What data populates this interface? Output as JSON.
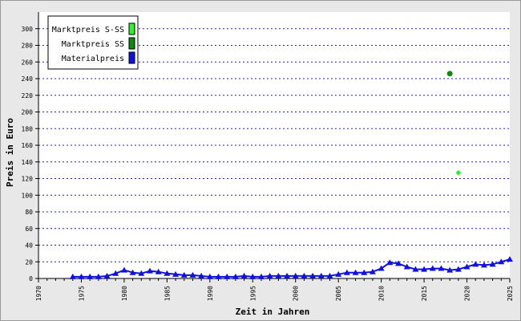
{
  "chart_data": {
    "type": "line",
    "title": "",
    "xlabel": "Zeit in Jahren",
    "ylabel": "Preis in Euro",
    "xlim": [
      1970,
      2025
    ],
    "ylim": [
      0,
      320
    ],
    "x_ticks": [
      "1970",
      "1975",
      "1980",
      "1985",
      "1990",
      "1995",
      "2000",
      "2005",
      "2010",
      "2015",
      "2020",
      "2025"
    ],
    "y_ticks": [
      "0",
      "20",
      "40",
      "60",
      "80",
      "100",
      "120",
      "140",
      "160",
      "180",
      "200",
      "220",
      "240",
      "260",
      "280",
      "300"
    ],
    "grid": true,
    "legend_position": "top-left",
    "series": [
      {
        "name": "Marktpreis S-SS",
        "color": "#33ee33",
        "marker": "diamond",
        "points": [
          [
            2019,
            127
          ]
        ]
      },
      {
        "name": "Marktpreis SS",
        "color": "#118811",
        "marker": "circle",
        "points": [
          [
            2018,
            246
          ]
        ]
      },
      {
        "name": "Materialpreis",
        "color": "#1111dd",
        "marker": "triangle",
        "points": [
          [
            1974,
            2
          ],
          [
            1975,
            2
          ],
          [
            1976,
            2
          ],
          [
            1977,
            2
          ],
          [
            1978,
            3
          ],
          [
            1979,
            6
          ],
          [
            1980,
            10
          ],
          [
            1981,
            7
          ],
          [
            1982,
            6
          ],
          [
            1983,
            9
          ],
          [
            1984,
            8
          ],
          [
            1985,
            6
          ],
          [
            1986,
            5
          ],
          [
            1987,
            4
          ],
          [
            1988,
            4
          ],
          [
            1989,
            3
          ],
          [
            1990,
            2
          ],
          [
            1991,
            2
          ],
          [
            1992,
            2
          ],
          [
            1993,
            2
          ],
          [
            1994,
            3
          ],
          [
            1995,
            2
          ],
          [
            1996,
            2
          ],
          [
            1997,
            3
          ],
          [
            1998,
            3
          ],
          [
            1999,
            3
          ],
          [
            2000,
            3
          ],
          [
            2001,
            3
          ],
          [
            2002,
            3
          ],
          [
            2003,
            3
          ],
          [
            2004,
            3
          ],
          [
            2005,
            5
          ],
          [
            2006,
            7
          ],
          [
            2007,
            7
          ],
          [
            2008,
            7
          ],
          [
            2009,
            8
          ],
          [
            2010,
            12
          ],
          [
            2011,
            19
          ],
          [
            2012,
            18
          ],
          [
            2013,
            14
          ],
          [
            2014,
            11
          ],
          [
            2015,
            11
          ],
          [
            2016,
            12
          ],
          [
            2017,
            12
          ],
          [
            2018,
            10
          ],
          [
            2019,
            11
          ],
          [
            2020,
            14
          ],
          [
            2021,
            17
          ],
          [
            2022,
            16
          ],
          [
            2023,
            17
          ],
          [
            2024,
            20
          ],
          [
            2025,
            23
          ]
        ]
      }
    ]
  }
}
